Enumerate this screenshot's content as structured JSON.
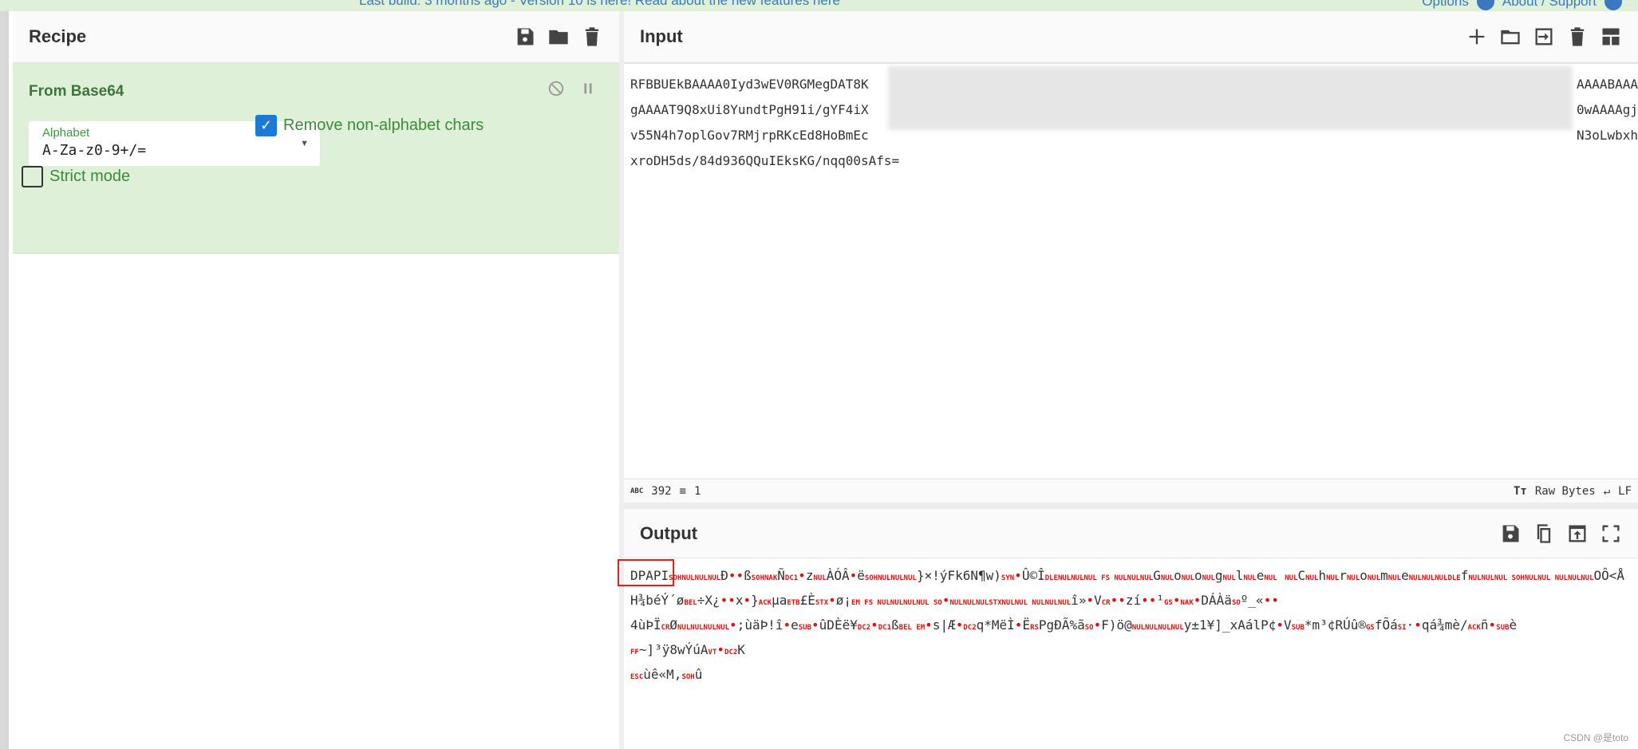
{
  "banner": {
    "message": "Last build: 3 months ago - Version 10 is here! Read about the new features here",
    "options": "Options",
    "about": "About / Support"
  },
  "recipe": {
    "title": "Recipe",
    "operation": {
      "name": "From Base64",
      "alphabet_label": "Alphabet",
      "alphabet_value": "A-Za-z0-9+/=",
      "remove_non_alphabet": {
        "label": "Remove non-alphabet chars",
        "checked": true
      },
      "strict_mode": {
        "label": "Strict mode",
        "checked": false
      }
    }
  },
  "input": {
    "title": "Input",
    "lines": [
      {
        "left": "RFBBUEkBAAAA0Iyd3wEV0RGMegDAT8K",
        "right": "AAAABAAA"
      },
      {
        "left": "gAAAAT9Q8xUi8YundtPgH91i/gYF4iX",
        "right": "0wAAAAgj"
      },
      {
        "left": "v55N4h7oplGov7RMjrpRKcEd8HoBmEc",
        "right": "N3oLwbxh"
      },
      {
        "left": "xroDH5ds/84d936QQuIEksKG/nqq00sAfs=",
        "right": ""
      }
    ],
    "status": {
      "length": "392",
      "lines": "1",
      "encoding": "Raw Bytes",
      "eol": "LF"
    }
  },
  "output": {
    "title": "Output",
    "lines": [
      [
        [
          "t",
          "DPAPI"
        ],
        [
          "c",
          "SOHNULNULNUL"
        ],
        [
          "t",
          "Ð"
        ],
        [
          "b",
          "••"
        ],
        [
          "t",
          "ß"
        ],
        [
          "c",
          "SOHNAK"
        ],
        [
          "t",
          "Ñ"
        ],
        [
          "c",
          "DC1"
        ],
        [
          "b",
          "•"
        ],
        [
          "t",
          "z"
        ],
        [
          "c",
          "NUL"
        ],
        [
          "t",
          "ÀÓÂ"
        ],
        [
          "b",
          "•"
        ],
        [
          "t",
          "ë"
        ],
        [
          "c",
          "SOHNULNULNUL"
        ],
        [
          "t",
          "}×!ýFk6N¶w)"
        ],
        [
          "c",
          "SYN"
        ],
        [
          "b",
          "•"
        ],
        [
          "t",
          "Û©Î"
        ],
        [
          "c",
          "DLENULNULNUL FS NULNULNUL"
        ],
        [
          "t",
          "G"
        ],
        [
          "c",
          "NUL"
        ],
        [
          "t",
          "o"
        ],
        [
          "c",
          "NUL"
        ],
        [
          "t",
          "o"
        ],
        [
          "c",
          "NUL"
        ],
        [
          "t",
          "g"
        ],
        [
          "c",
          "NUL"
        ],
        [
          "t",
          "l"
        ],
        [
          "c",
          "NUL"
        ],
        [
          "t",
          "e"
        ],
        [
          "c",
          "NUL"
        ],
        [
          "t",
          " "
        ],
        [
          "c",
          "NUL"
        ],
        [
          "t",
          "C"
        ],
        [
          "c",
          "NUL"
        ],
        [
          "t",
          "h"
        ],
        [
          "c",
          "NUL"
        ],
        [
          "t",
          "r"
        ],
        [
          "c",
          "NUL"
        ],
        [
          "t",
          "o"
        ],
        [
          "c",
          "NUL"
        ],
        [
          "t",
          "m"
        ],
        [
          "c",
          "NUL"
        ],
        [
          "t",
          "e"
        ],
        [
          "c",
          "NULNULNULDLE"
        ],
        [
          "t",
          "f"
        ],
        [
          "c",
          "NULNULNUL SOHNULNUL  NULNULNUL"
        ],
        [
          "t",
          "OÔ<ÅH¾béÝ´ø"
        ],
        [
          "c",
          "BEL"
        ],
        [
          "t",
          "÷X¿"
        ],
        [
          "b",
          "••"
        ],
        [
          "t",
          "x"
        ],
        [
          "b",
          "•"
        ],
        [
          "t",
          "}"
        ],
        [
          "c",
          "ACK"
        ],
        [
          "t",
          "µa"
        ],
        [
          "c",
          "ETB"
        ],
        [
          "t",
          "£È"
        ],
        [
          "c",
          "STX"
        ],
        [
          "b",
          "•"
        ],
        [
          "t",
          "ø¡"
        ],
        [
          "c",
          "EM FS NULNULNULNUL SO"
        ],
        [
          "b",
          "•"
        ],
        [
          "c",
          "NULNULNULSTXNULNUL  NULNULNUL"
        ],
        [
          "t",
          "î»"
        ],
        [
          "b",
          "•"
        ],
        [
          "t",
          "V"
        ],
        [
          "c",
          "CR"
        ],
        [
          "b",
          "••"
        ],
        [
          "t",
          "zí"
        ],
        [
          "b",
          "••"
        ],
        [
          "t",
          "¹"
        ],
        [
          "c",
          "GS"
        ],
        [
          "b",
          "•"
        ],
        [
          "c",
          "NAK"
        ],
        [
          "b",
          "•"
        ],
        [
          "t",
          "DÁÀä"
        ],
        [
          "c",
          "SO"
        ],
        [
          "t",
          "º_«"
        ],
        [
          "b",
          "••"
        ]
      ],
      [
        [
          "t",
          "4ùÞÏ"
        ],
        [
          "c",
          "CR"
        ],
        [
          "t",
          "Ø"
        ],
        [
          "c",
          "NULNULNULNUL"
        ],
        [
          "b",
          "•"
        ],
        [
          "t",
          ";ùäÞ!î"
        ],
        [
          "b",
          "•"
        ],
        [
          "t",
          "e"
        ],
        [
          "c",
          "SUB"
        ],
        [
          "b",
          "•"
        ],
        [
          "t",
          "ûDÈë¥"
        ],
        [
          "c",
          "DC2"
        ],
        [
          "b",
          "•"
        ],
        [
          "c",
          "DC1"
        ],
        [
          "t",
          "ß"
        ],
        [
          "c",
          "BEL  EM"
        ],
        [
          "b",
          "•"
        ],
        [
          "t",
          "s|Æ"
        ],
        [
          "b",
          "•"
        ],
        [
          "c",
          "DC2"
        ],
        [
          "t",
          "q*MëÌ"
        ],
        [
          "b",
          "•"
        ],
        [
          "t",
          "Ë"
        ],
        [
          "c",
          "RS"
        ],
        [
          "t",
          "PgÐÃ%ã"
        ],
        [
          "c",
          "SO"
        ],
        [
          "b",
          "•"
        ],
        [
          "t",
          "F)ö@"
        ],
        [
          "c",
          "NULNULNULNUL"
        ],
        [
          "t",
          "y±1¥]_xAálP¢"
        ],
        [
          "b",
          "•"
        ],
        [
          "t",
          "V"
        ],
        [
          "c",
          "SUB"
        ],
        [
          "t",
          "*m³¢RÚû®"
        ],
        [
          "c",
          "GS"
        ],
        [
          "t",
          "fÕá"
        ],
        [
          "c",
          "SI"
        ],
        [
          "t",
          "·"
        ],
        [
          "b",
          "•"
        ],
        [
          "t",
          "qá¾mè/"
        ],
        [
          "c",
          "ACK"
        ],
        [
          "t",
          "ñ"
        ],
        [
          "b",
          "•"
        ],
        [
          "c",
          "SUB"
        ],
        [
          "t",
          "è"
        ]
      ],
      [
        [
          "c",
          "FF"
        ],
        [
          "t",
          "~]³ÿ8wÝúA"
        ],
        [
          "c",
          "VT"
        ],
        [
          "b",
          "•"
        ],
        [
          "c",
          "DC2"
        ],
        [
          "t",
          "K"
        ]
      ],
      [
        [
          "c",
          "ESC"
        ],
        [
          "t",
          "ùê«M,"
        ],
        [
          "c",
          "SOH"
        ],
        [
          "t",
          "û"
        ]
      ]
    ]
  },
  "watermark": "CSDN @是toto",
  "colors": {
    "accent": "#1a7ad4",
    "recipe_bg": "#dff0d8",
    "control_char": "#e01010",
    "highlight_box": "#e02020"
  }
}
